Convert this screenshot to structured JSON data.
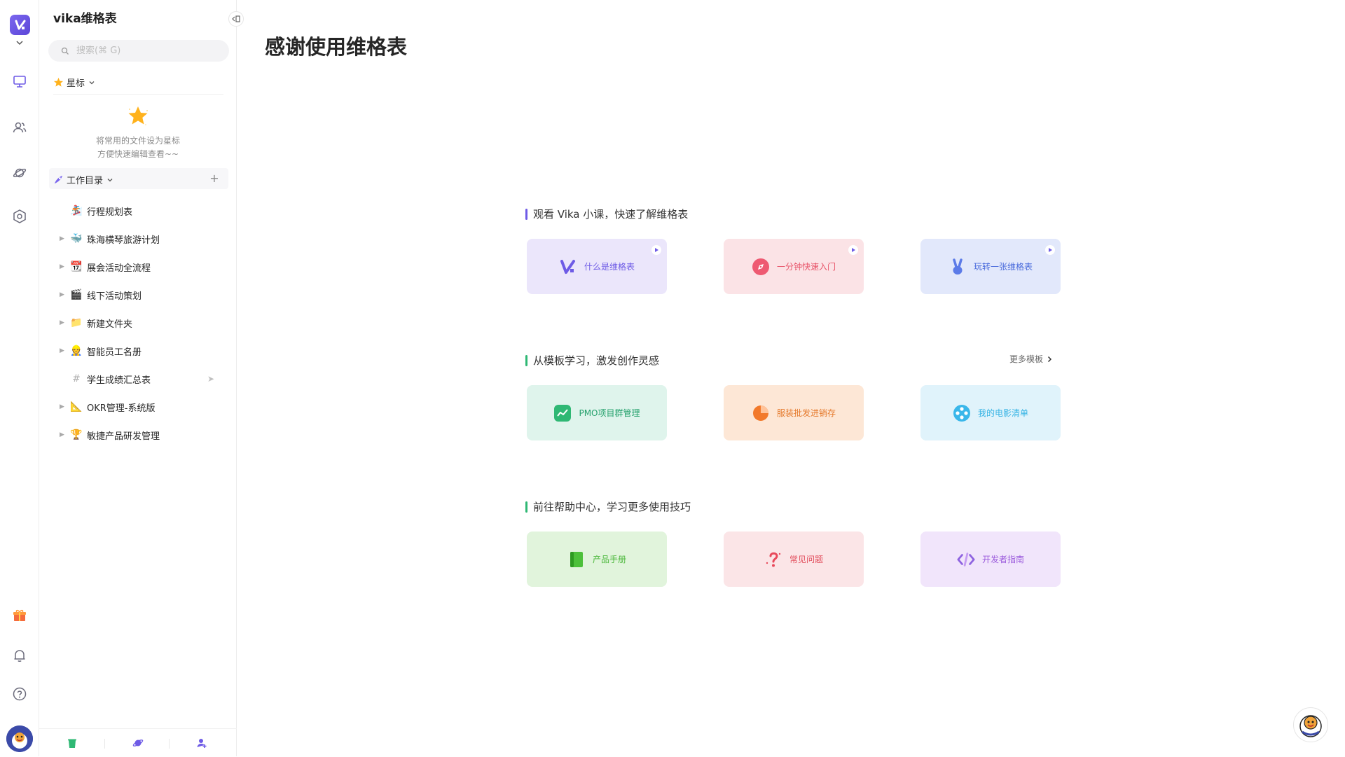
{
  "colors": {
    "brand": "#6e5be6",
    "rail_icon": "#6b6b7b",
    "star": "#ffb21c"
  },
  "rail": {
    "logo_icon": "vika-logo-icon",
    "items": [
      {
        "name": "workbench",
        "icon": "monitor-icon"
      },
      {
        "name": "members",
        "icon": "users-icon"
      },
      {
        "name": "templates",
        "icon": "planet-icon"
      },
      {
        "name": "settings",
        "icon": "hexagon-settings-icon"
      },
      {
        "name": "gift",
        "icon": "gift-icon"
      },
      {
        "name": "notifications",
        "icon": "bell-icon"
      },
      {
        "name": "help",
        "icon": "help-icon"
      }
    ]
  },
  "sidebar": {
    "space_name": "vika维格表",
    "search_placeholder": "搜索(⌘ G)",
    "starred": {
      "label": "星标",
      "empty_line1": "将常用的文件设为星标",
      "empty_line2": "方便快速编辑查看~~"
    },
    "catalog": {
      "label": "工作目录",
      "add": "+"
    },
    "tree": [
      {
        "label": "行程规划表",
        "emoji": "🏂",
        "has_children": false,
        "shared": false
      },
      {
        "label": "珠海横琴旅游计划",
        "emoji": "🐳",
        "has_children": true,
        "shared": false
      },
      {
        "label": "展会活动全流程",
        "emoji": "📆",
        "has_children": true,
        "shared": false
      },
      {
        "label": "线下活动策划",
        "emoji": "🎬",
        "has_children": true,
        "shared": false
      },
      {
        "label": "新建文件夹",
        "emoji": "📁",
        "has_children": true,
        "shared": false
      },
      {
        "label": "智能员工名册",
        "emoji": "👷",
        "has_children": true,
        "shared": false
      },
      {
        "label": "学生成绩汇总表",
        "emoji": "#",
        "has_children": false,
        "shared": true
      },
      {
        "label": "OKR管理-系统版",
        "emoji": "📐",
        "has_children": true,
        "shared": false
      },
      {
        "label": "敏捷产品研发管理",
        "emoji": "🏆",
        "has_children": true,
        "shared": false
      }
    ],
    "bottom": [
      {
        "name": "trash",
        "icon": "trash-icon"
      },
      {
        "name": "templates",
        "icon": "planet-icon"
      },
      {
        "name": "invite",
        "icon": "add-member-icon"
      }
    ]
  },
  "main": {
    "title": "感谢使用维格表",
    "sections": [
      {
        "title": "观看 Vika 小课，快速了解维格表",
        "bar_color": "#6e5be6",
        "cards": [
          {
            "label": "什么是维格表",
            "bg": "#ebe6fb",
            "fg": "#6e5be6",
            "icon": "vika-logo-icon",
            "video": true
          },
          {
            "label": "一分钟快速入门",
            "bg": "#fbe3e6",
            "fg": "#e8556a",
            "icon": "compass-icon",
            "video": true
          },
          {
            "label": "玩转一张维格表",
            "bg": "#e2e8fb",
            "fg": "#4a6bdc",
            "icon": "victory-hand-icon",
            "video": true
          }
        ]
      },
      {
        "title": "从模板学习，激发创作灵感",
        "bar_color": "#2fb874",
        "more_label": "更多模板",
        "cards": [
          {
            "label": "PMO项目群管理",
            "bg": "#dff4ec",
            "fg": "#23a06b",
            "icon": "chart-line-icon",
            "video": false
          },
          {
            "label": "服装批发进销存",
            "bg": "#fde7d6",
            "fg": "#e57a2c",
            "icon": "pie-chart-icon",
            "video": false
          },
          {
            "label": "我的电影清单",
            "bg": "#e0f3fb",
            "fg": "#35b3e4",
            "icon": "film-reel-icon",
            "video": false
          }
        ]
      },
      {
        "title": "前往帮助中心，学习更多使用技巧",
        "bar_color": "#2fb874",
        "cards": [
          {
            "label": "产品手册",
            "bg": "#e1f4dc",
            "fg": "#4cb83c",
            "icon": "book-icon",
            "video": false
          },
          {
            "label": "常见问题",
            "bg": "#fbe5e7",
            "fg": "#e24d5c",
            "icon": "question-icon",
            "video": false
          },
          {
            "label": "开发者指南",
            "bg": "#f1e5fb",
            "fg": "#9b5bdc",
            "icon": "code-icon",
            "video": false
          }
        ]
      }
    ]
  }
}
